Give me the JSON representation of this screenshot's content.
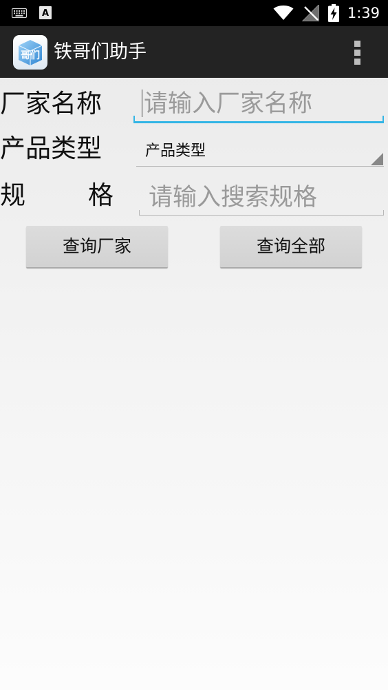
{
  "status_bar": {
    "time": "1:39",
    "notification_letter": "A",
    "icons": [
      "keyboard-icon",
      "a-notification-icon",
      "wifi-icon",
      "no-signal-icon",
      "battery-charging-icon"
    ]
  },
  "action_bar": {
    "title": "铁哥们助手",
    "icon_text": "哥们",
    "menu_icon": "overflow-menu-icon"
  },
  "form": {
    "vendor": {
      "label": "厂家名称",
      "placeholder": "请输入厂家名称",
      "value": ""
    },
    "product_type": {
      "label": "产品类型",
      "selected": "产品类型"
    },
    "spec": {
      "label_first": "规",
      "label_second": "格",
      "placeholder": "请输入搜索规格",
      "value": ""
    }
  },
  "buttons": {
    "query_vendor": "查询厂家",
    "query_all": "查询全部"
  },
  "colors": {
    "status_bar": "#000000",
    "action_bar": "#232323",
    "focus_accent": "#33b5e5",
    "button": "#d6d6d6",
    "app_icon": "#5aa9e6"
  }
}
